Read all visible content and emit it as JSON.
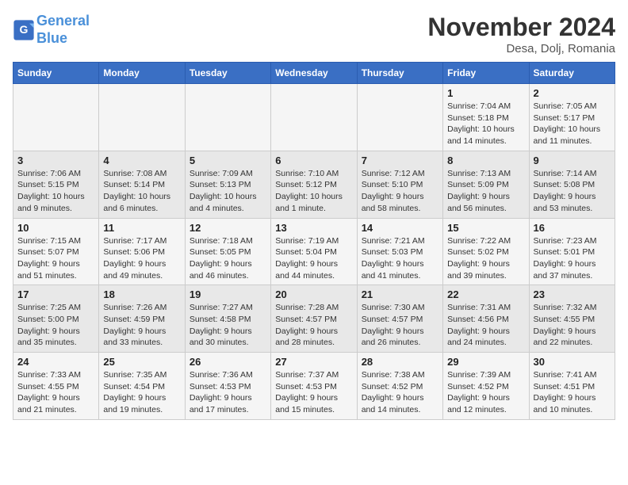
{
  "header": {
    "logo_line1": "General",
    "logo_line2": "Blue",
    "month": "November 2024",
    "location": "Desa, Dolj, Romania"
  },
  "weekdays": [
    "Sunday",
    "Monday",
    "Tuesday",
    "Wednesday",
    "Thursday",
    "Friday",
    "Saturday"
  ],
  "weeks": [
    [
      {
        "day": "",
        "info": ""
      },
      {
        "day": "",
        "info": ""
      },
      {
        "day": "",
        "info": ""
      },
      {
        "day": "",
        "info": ""
      },
      {
        "day": "",
        "info": ""
      },
      {
        "day": "1",
        "info": "Sunrise: 7:04 AM\nSunset: 5:18 PM\nDaylight: 10 hours and 14 minutes."
      },
      {
        "day": "2",
        "info": "Sunrise: 7:05 AM\nSunset: 5:17 PM\nDaylight: 10 hours and 11 minutes."
      }
    ],
    [
      {
        "day": "3",
        "info": "Sunrise: 7:06 AM\nSunset: 5:15 PM\nDaylight: 10 hours and 9 minutes."
      },
      {
        "day": "4",
        "info": "Sunrise: 7:08 AM\nSunset: 5:14 PM\nDaylight: 10 hours and 6 minutes."
      },
      {
        "day": "5",
        "info": "Sunrise: 7:09 AM\nSunset: 5:13 PM\nDaylight: 10 hours and 4 minutes."
      },
      {
        "day": "6",
        "info": "Sunrise: 7:10 AM\nSunset: 5:12 PM\nDaylight: 10 hours and 1 minute."
      },
      {
        "day": "7",
        "info": "Sunrise: 7:12 AM\nSunset: 5:10 PM\nDaylight: 9 hours and 58 minutes."
      },
      {
        "day": "8",
        "info": "Sunrise: 7:13 AM\nSunset: 5:09 PM\nDaylight: 9 hours and 56 minutes."
      },
      {
        "day": "9",
        "info": "Sunrise: 7:14 AM\nSunset: 5:08 PM\nDaylight: 9 hours and 53 minutes."
      }
    ],
    [
      {
        "day": "10",
        "info": "Sunrise: 7:15 AM\nSunset: 5:07 PM\nDaylight: 9 hours and 51 minutes."
      },
      {
        "day": "11",
        "info": "Sunrise: 7:17 AM\nSunset: 5:06 PM\nDaylight: 9 hours and 49 minutes."
      },
      {
        "day": "12",
        "info": "Sunrise: 7:18 AM\nSunset: 5:05 PM\nDaylight: 9 hours and 46 minutes."
      },
      {
        "day": "13",
        "info": "Sunrise: 7:19 AM\nSunset: 5:04 PM\nDaylight: 9 hours and 44 minutes."
      },
      {
        "day": "14",
        "info": "Sunrise: 7:21 AM\nSunset: 5:03 PM\nDaylight: 9 hours and 41 minutes."
      },
      {
        "day": "15",
        "info": "Sunrise: 7:22 AM\nSunset: 5:02 PM\nDaylight: 9 hours and 39 minutes."
      },
      {
        "day": "16",
        "info": "Sunrise: 7:23 AM\nSunset: 5:01 PM\nDaylight: 9 hours and 37 minutes."
      }
    ],
    [
      {
        "day": "17",
        "info": "Sunrise: 7:25 AM\nSunset: 5:00 PM\nDaylight: 9 hours and 35 minutes."
      },
      {
        "day": "18",
        "info": "Sunrise: 7:26 AM\nSunset: 4:59 PM\nDaylight: 9 hours and 33 minutes."
      },
      {
        "day": "19",
        "info": "Sunrise: 7:27 AM\nSunset: 4:58 PM\nDaylight: 9 hours and 30 minutes."
      },
      {
        "day": "20",
        "info": "Sunrise: 7:28 AM\nSunset: 4:57 PM\nDaylight: 9 hours and 28 minutes."
      },
      {
        "day": "21",
        "info": "Sunrise: 7:30 AM\nSunset: 4:57 PM\nDaylight: 9 hours and 26 minutes."
      },
      {
        "day": "22",
        "info": "Sunrise: 7:31 AM\nSunset: 4:56 PM\nDaylight: 9 hours and 24 minutes."
      },
      {
        "day": "23",
        "info": "Sunrise: 7:32 AM\nSunset: 4:55 PM\nDaylight: 9 hours and 22 minutes."
      }
    ],
    [
      {
        "day": "24",
        "info": "Sunrise: 7:33 AM\nSunset: 4:55 PM\nDaylight: 9 hours and 21 minutes."
      },
      {
        "day": "25",
        "info": "Sunrise: 7:35 AM\nSunset: 4:54 PM\nDaylight: 9 hours and 19 minutes."
      },
      {
        "day": "26",
        "info": "Sunrise: 7:36 AM\nSunset: 4:53 PM\nDaylight: 9 hours and 17 minutes."
      },
      {
        "day": "27",
        "info": "Sunrise: 7:37 AM\nSunset: 4:53 PM\nDaylight: 9 hours and 15 minutes."
      },
      {
        "day": "28",
        "info": "Sunrise: 7:38 AM\nSunset: 4:52 PM\nDaylight: 9 hours and 14 minutes."
      },
      {
        "day": "29",
        "info": "Sunrise: 7:39 AM\nSunset: 4:52 PM\nDaylight: 9 hours and 12 minutes."
      },
      {
        "day": "30",
        "info": "Sunrise: 7:41 AM\nSunset: 4:51 PM\nDaylight: 9 hours and 10 minutes."
      }
    ]
  ]
}
